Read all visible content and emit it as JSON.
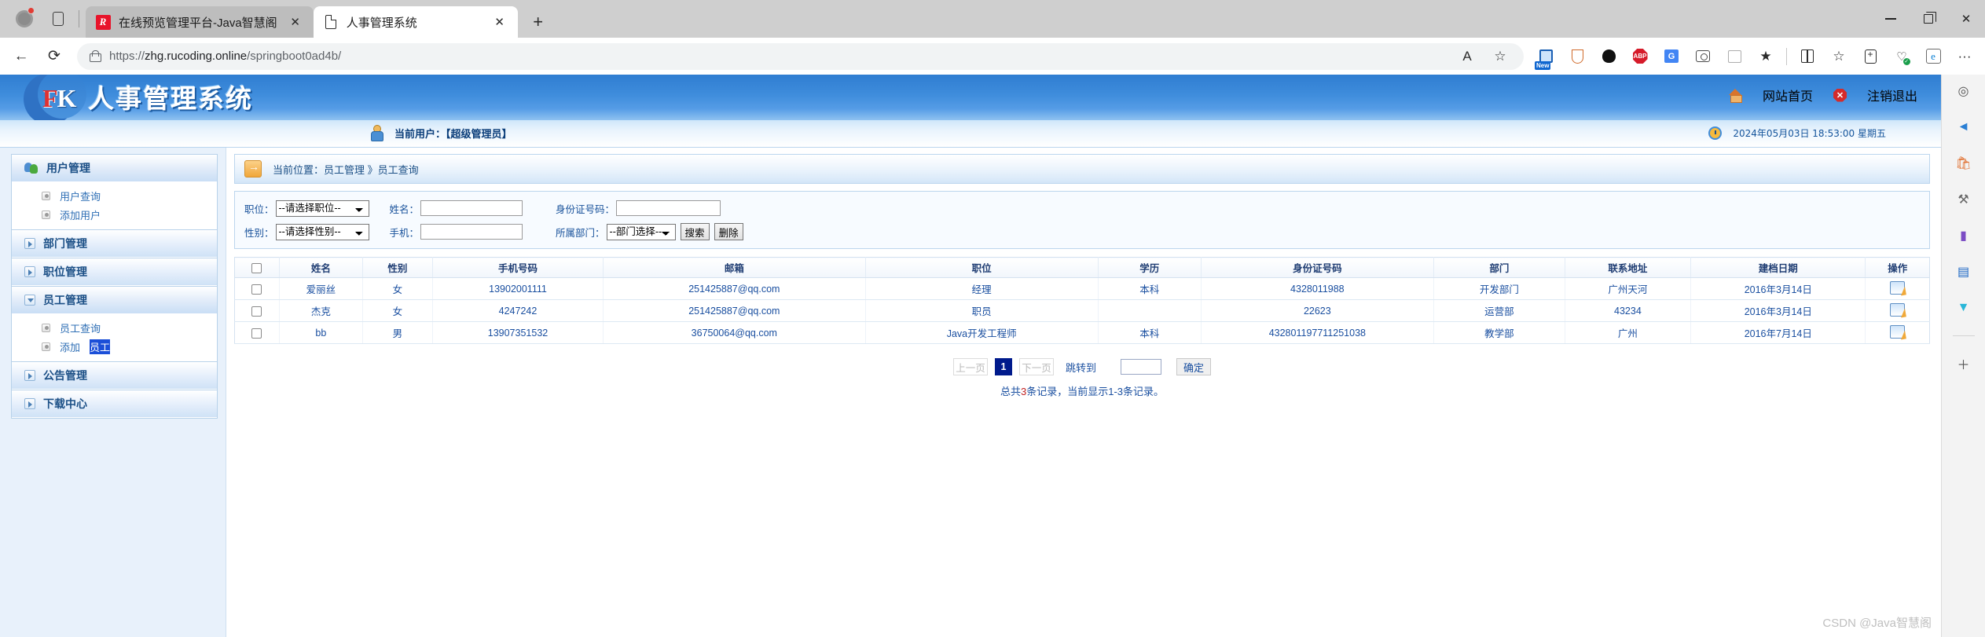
{
  "browser": {
    "tabs": [
      {
        "title": "在线预览管理平台-Java智慧阁",
        "active": false,
        "favicon": "r-logo-icon",
        "close_label": "✕"
      },
      {
        "title": "人事管理系统",
        "active": true,
        "favicon": "document-icon",
        "close_label": "✕"
      }
    ],
    "newtab_label": "+",
    "back_label": "←",
    "reload_label": "⟳",
    "url_scheme": "https://",
    "url_host": "zhg.rucoding.online",
    "url_path": "/springboot0ad4b/",
    "read_aloud_label": "A",
    "favorite_label": "☆",
    "toolbar_badge": "New",
    "more_label": "···",
    "window": {
      "minimize": "—",
      "maximize": "❐",
      "close": "✕"
    }
  },
  "app": {
    "logo_f": "F",
    "logo_k": "K",
    "title": "人事管理系统",
    "home_link": "网站首页",
    "logout_link": "注销退出",
    "current_user": "当前用户：【超级管理员】",
    "datetime": "2024年05月03日 18:53:00 星期五"
  },
  "sidebar": {
    "groups": [
      {
        "label": "用户管理",
        "icon": "users-icon",
        "expanded": true,
        "items": [
          {
            "label": "用户查询"
          },
          {
            "label": "添加用户"
          }
        ]
      },
      {
        "label": "部门管理",
        "icon": "chevron-right-icon",
        "expanded": false,
        "items": []
      },
      {
        "label": "职位管理",
        "icon": "chevron-right-icon",
        "expanded": false,
        "items": []
      },
      {
        "label": "员工管理",
        "icon": "chevron-down-icon",
        "expanded": true,
        "items": [
          {
            "label": "员工查询"
          },
          {
            "label": "添加",
            "highlight": "员工"
          }
        ]
      },
      {
        "label": "公告管理",
        "icon": "chevron-right-icon",
        "expanded": false,
        "items": []
      },
      {
        "label": "下载中心",
        "icon": "chevron-right-icon",
        "expanded": false,
        "items": []
      }
    ]
  },
  "breadcrumb": {
    "icon": "arrow-right-icon",
    "text": "当前位置：员工管理 》员工查询"
  },
  "search_form": {
    "position_label": "职位：",
    "position_value": "--请选择职位--",
    "name_label": "姓名：",
    "name_value": "",
    "idcard_label": "身份证号码：",
    "idcard_value": "",
    "gender_label": "性别：",
    "gender_value": "--请选择性别--",
    "phone_label": "手机：",
    "phone_value": "",
    "dept_label": "所属部门：",
    "dept_value": "--部门选择--",
    "search_button": "搜索",
    "delete_button": "删除"
  },
  "table": {
    "columns": [
      "",
      "姓名",
      "性别",
      "手机号码",
      "邮箱",
      "职位",
      "学历",
      "身份证号码",
      "部门",
      "联系地址",
      "建档日期",
      "操作"
    ],
    "rows": [
      {
        "name": "爱丽丝",
        "gender": "女",
        "phone": "13902001111",
        "email": "251425887@qq.com",
        "position": "经理",
        "education": "本科",
        "idcard": "4328011988",
        "dept": "开发部门",
        "address": "广州天河",
        "date": "2016年3月14日",
        "action": "edit-icon"
      },
      {
        "name": "杰克",
        "gender": "女",
        "phone": "4247242",
        "email": "251425887@qq.com",
        "position": "职员",
        "education": "",
        "idcard": "22623",
        "dept": "运营部",
        "address": "43234",
        "date": "2016年3月14日",
        "action": "edit-icon"
      },
      {
        "name": "bb",
        "gender": "男",
        "phone": "13907351532",
        "email": "36750064@qq.com",
        "position": "Java开发工程师",
        "education": "本科",
        "idcard": "432801197711251038",
        "dept": "教学部",
        "address": "广州",
        "date": "2016年7月14日",
        "action": "edit-icon"
      }
    ]
  },
  "pagination": {
    "prev": "上一页",
    "current": "1",
    "next": "下一页",
    "jump_label": "跳转到",
    "jump_value": "",
    "confirm": "确定",
    "summary_prefix": "总共",
    "summary_count": "3",
    "summary_suffix": "条记录，当前显示1-3条记录。"
  },
  "watermark": "CSDN @Java智慧阁"
}
